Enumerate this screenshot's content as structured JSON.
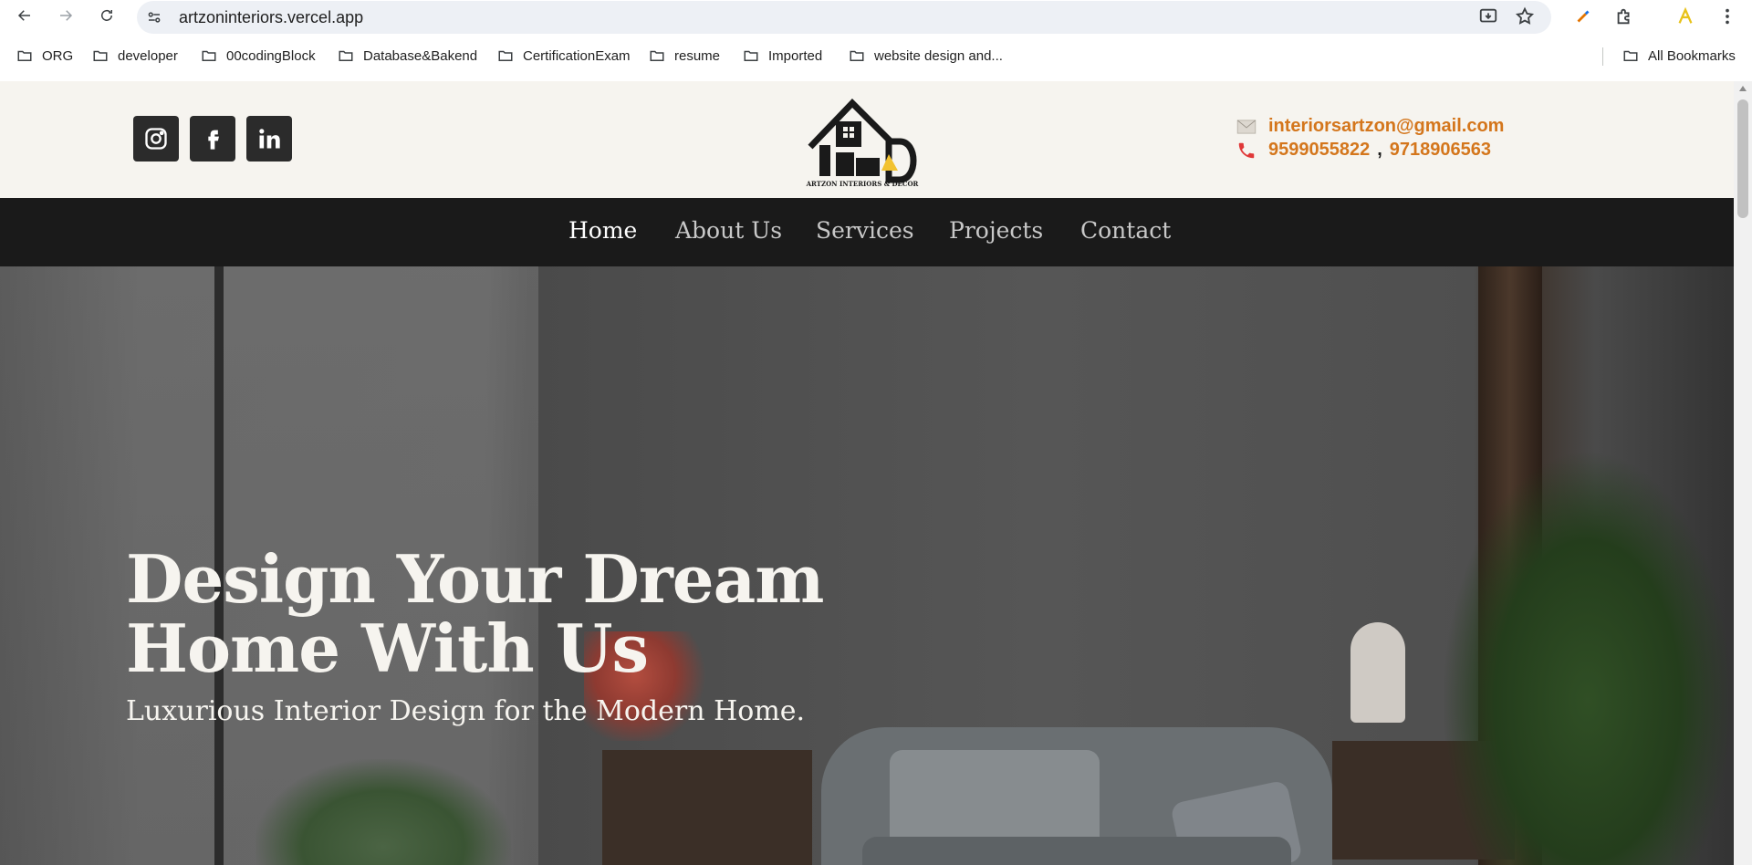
{
  "browser": {
    "url": "artzoninteriors.vercel.app",
    "bookmarks": [
      "ORG",
      "developer",
      "00codingBlock",
      "Database&Bakend",
      "CertificationExam",
      "resume",
      "Imported",
      "website design and...",
      "All Bookmarks"
    ]
  },
  "header": {
    "logo_text": "ARTZON INTERIORS & DECOR",
    "email": "interiorsartzon@gmail.com",
    "phone1": "9599055822",
    "phone_sep": ",",
    "phone2": "9718906563"
  },
  "nav": {
    "items": [
      "Home",
      "About Us",
      "Services",
      "Projects",
      "Contact"
    ],
    "active": "Home"
  },
  "hero": {
    "title_line1": "Design Your Dream",
    "title_line2": "Home With Us",
    "subtitle": "Luxurious Interior Design for the Modern Home."
  },
  "colors": {
    "accent": "#d4761c",
    "header_bg": "#f6f4ef",
    "nav_bg": "#1a1a1a",
    "social_bg": "#2b2b2b"
  }
}
